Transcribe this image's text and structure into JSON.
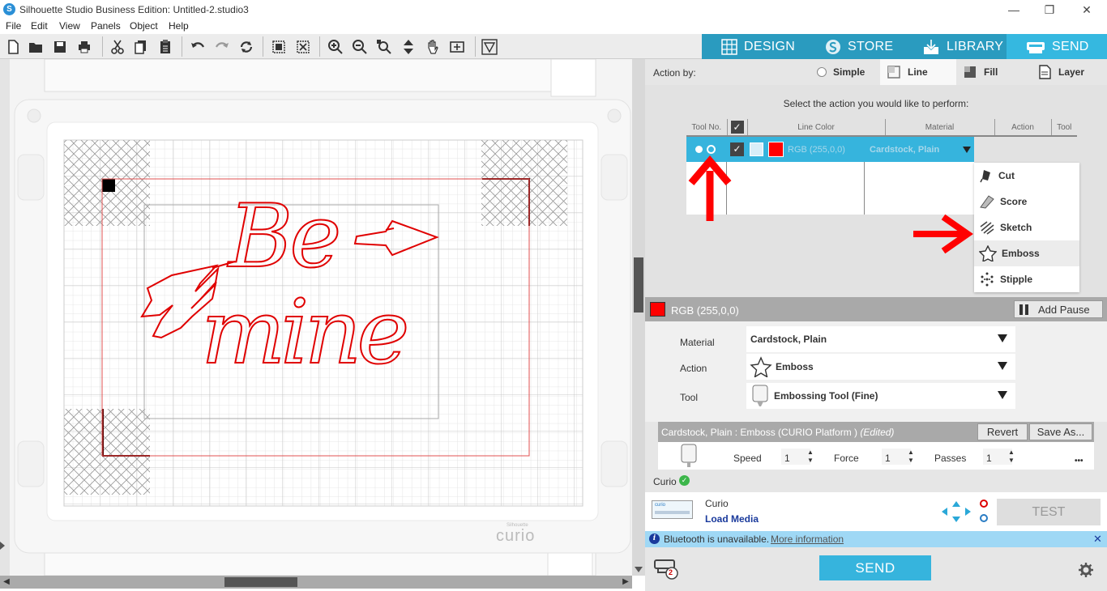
{
  "window": {
    "title": "Silhouette Studio Business Edition: Untitled-2.studio3",
    "app_icon": "S",
    "controls": [
      "—",
      "❐",
      "✕"
    ]
  },
  "menu": [
    "File",
    "Edit",
    "View",
    "Panels",
    "Object",
    "Help"
  ],
  "top_tabs": [
    {
      "label": "DESIGN",
      "icon": "grid-icon"
    },
    {
      "label": "STORE",
      "icon": "silhouette-s-icon"
    },
    {
      "label": "LIBRARY",
      "icon": "download-icon"
    },
    {
      "label": "SEND",
      "icon": "cutter-icon",
      "active": true
    }
  ],
  "canvas": {
    "design_text_line1": "Be",
    "design_text_line2": "mine",
    "machine_logo": "curio",
    "machine_logo_small": "Silhouette"
  },
  "panel": {
    "action_by_label": "Action by:",
    "action_by_tabs": [
      "Simple",
      "Line",
      "Fill",
      "Layer"
    ],
    "action_by_selected": "Line",
    "instruction": "Select the action you would like to perform:",
    "table": {
      "headers": [
        "Tool No.",
        "",
        "Line Color",
        "Material",
        "Action",
        "Tool"
      ],
      "rows": [
        {
          "color_label": "RGB (255,0,0)",
          "material": "Cardstock, Plain",
          "checked": true
        }
      ]
    },
    "action_options": [
      "Cut",
      "Score",
      "Sketch",
      "Emboss",
      "Stipple"
    ],
    "action_highlighted": "Emboss",
    "color_bar": {
      "label": "RGB (255,0,0)",
      "swatch": "#ff0000",
      "add_pause": "Add Pause"
    },
    "settings": {
      "material_label": "Material",
      "material_value": "Cardstock, Plain",
      "action_label": "Action",
      "action_value": "Emboss",
      "tool_label": "Tool",
      "tool_value": "Embossing Tool (Fine)"
    },
    "preset": {
      "text": "Cardstock, Plain : Emboss (CURIO Platform )",
      "edited": "(Edited)",
      "revert": "Revert",
      "save_as": "Save As..."
    },
    "params": {
      "speed_label": "Speed",
      "speed": "1",
      "force_label": "Force",
      "force": "1",
      "passes_label": "Passes",
      "passes": "1",
      "more": "•••"
    },
    "machine": {
      "name": "Curio",
      "status": "connected"
    },
    "device": {
      "name": "Curio",
      "load_media": "Load Media",
      "thumb_label": "curio",
      "test": "TEST"
    },
    "notify": {
      "text": "Bluetooth is unavailable.",
      "link": "More information",
      "close": "✕"
    },
    "send": "SEND",
    "queue_count": "2"
  },
  "colors": {
    "accent": "#36b4dd",
    "tab_bar": "#2a9bbf",
    "cut_line": "#e00000",
    "arrow": "#ff0000"
  }
}
